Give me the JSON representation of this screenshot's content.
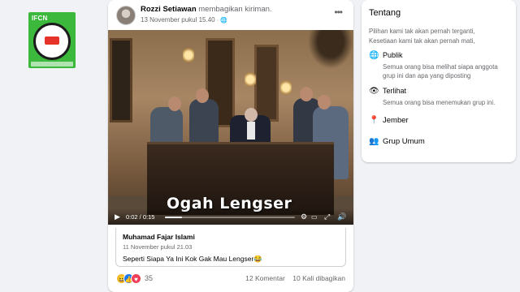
{
  "post": {
    "author": "Rozzi Setiawan",
    "action": "membagikan kiriman.",
    "timestamp": "13 November pukul 15.40",
    "more_label": "•••"
  },
  "video": {
    "caption": "Ogah Lengser",
    "time": "0:02 / 0:15",
    "progress": 0.13
  },
  "shared_post": {
    "author": "Muhamad Fajar Islami",
    "timestamp": "11 November pukul 21.03",
    "text": "Seperti Siapa Ya Ini Kok Gak Mau Lengser😂"
  },
  "engagement": {
    "reactions": [
      "haha",
      "like",
      "love"
    ],
    "reaction_count": "35",
    "comments": "12 Komentar",
    "shares": "10 Kali dibagikan"
  },
  "about": {
    "title": "Tentang",
    "description_line1": "Pilihan kami tak akan pernah terganti,",
    "description_line2": "Kesetiaan kami tak akan pernah mati,",
    "public_title": "Publik",
    "public_desc_line1": "Semua orang bisa melihat siapa anggota",
    "public_desc_line2": "grup ini dan apa yang diposting",
    "visible_title": "Terlihat",
    "visible_desc": "Semua orang bisa menemukan grup ini.",
    "location": "Jember",
    "group_type": "Grup Umum"
  },
  "badge": {
    "text": "IFCN",
    "icon": "ifcn-signatory-badge"
  },
  "colors": {
    "badge_green": "#3cb93c",
    "link_blue": "#1877f2",
    "muted_text": "#65676b"
  }
}
